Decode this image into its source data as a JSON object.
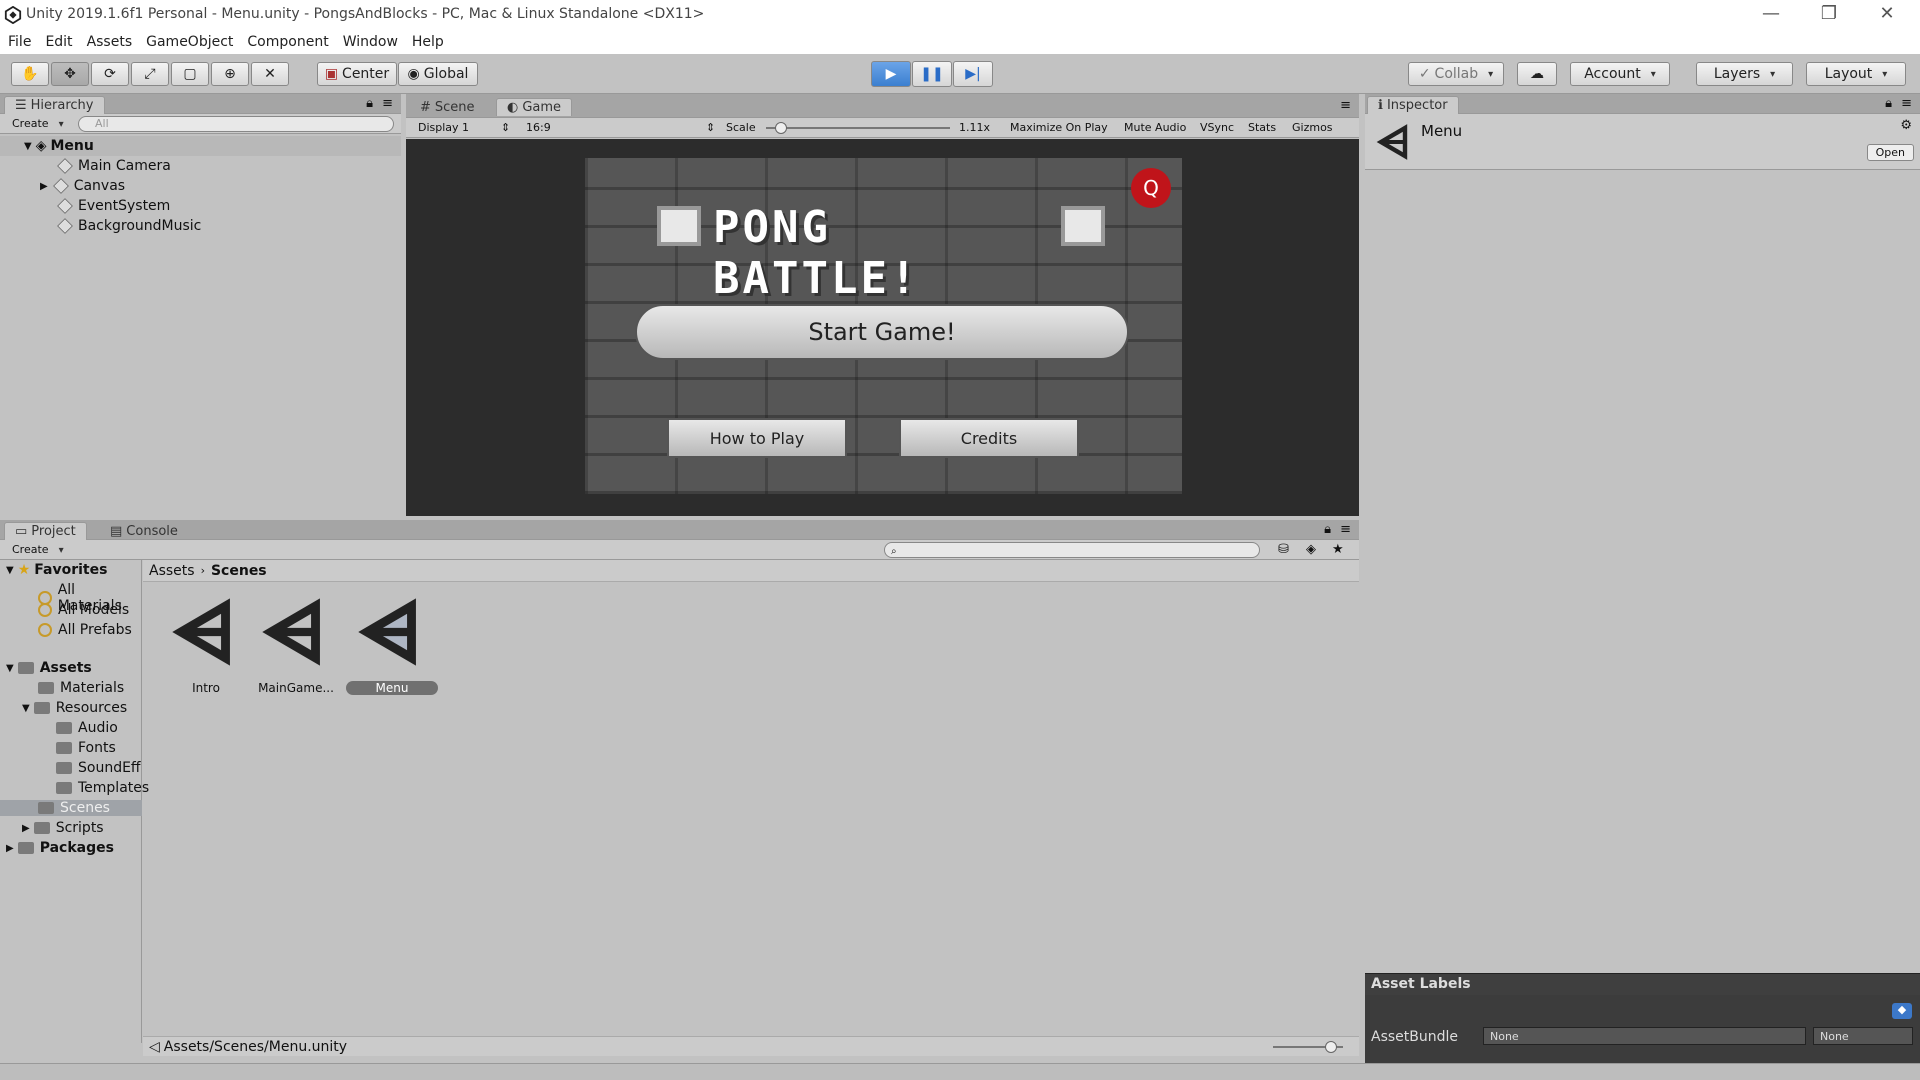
{
  "window": {
    "title": "Unity 2019.1.6f1 Personal - Menu.unity - PongsAndBlocks - PC, Mac & Linux Standalone <DX11>",
    "minimize": "—",
    "restore": "❐",
    "close": "✕"
  },
  "menubar": [
    "File",
    "Edit",
    "Assets",
    "GameObject",
    "Component",
    "Window",
    "Help"
  ],
  "toolbar": {
    "pivot_mode": "Center",
    "pivot_rotation": "Global",
    "collab": "Collab",
    "account": "Account",
    "layers": "Layers",
    "layout": "Layout"
  },
  "hierarchy": {
    "tab": "Hierarchy",
    "create": "Create",
    "search_placeholder": "All",
    "scene": "Menu",
    "items": [
      "Main Camera",
      "Canvas",
      "EventSystem",
      "BackgroundMusic"
    ]
  },
  "scene_tabs": {
    "scene": "Scene",
    "game": "Game"
  },
  "game_toolbar": {
    "display": "Display 1",
    "aspect": "16:9",
    "scale_label": "Scale",
    "scale_value": "1.11x",
    "scale_fraction": 0.05,
    "maximize": "Maximize On Play",
    "mute": "Mute Audio",
    "vsync": "VSync",
    "stats": "Stats",
    "gizmos": "Gizmos"
  },
  "game": {
    "title": "PONG BATTLE!",
    "start": "Start Game!",
    "how_to_play": "How to Play",
    "credits": "Credits",
    "quit": "Q"
  },
  "project": {
    "tab_project": "Project",
    "tab_console": "Console",
    "create": "Create",
    "favorites": "Favorites",
    "fav_items": [
      "All Materials",
      "All Models",
      "All Prefabs"
    ],
    "assets": "Assets",
    "tree": [
      "Materials",
      "Resources",
      "Audio",
      "Fonts",
      "SoundEff",
      "Templates",
      "Scenes",
      "Scripts"
    ],
    "packages": "Packages",
    "breadcrumb": [
      "Assets",
      "Scenes"
    ],
    "files": [
      "Intro",
      "MainGame...",
      "Menu"
    ],
    "status_path": "Assets/Scenes/Menu.unity"
  },
  "inspector": {
    "tab": "Inspector",
    "object": "Menu",
    "open": "Open",
    "asset_labels": "Asset Labels",
    "assetbundle_label": "AssetBundle",
    "bundle_value": "None",
    "variant_value": "None"
  },
  "colors": {
    "play_blue": "#3b7fd0",
    "quit_red": "#c0141a"
  }
}
